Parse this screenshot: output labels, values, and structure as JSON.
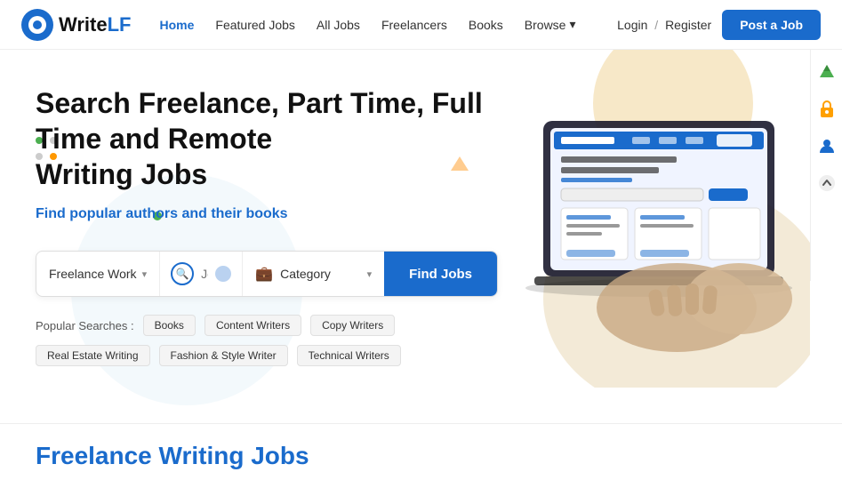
{
  "navbar": {
    "logo_write": "Write",
    "logo_lf": "LF",
    "links": [
      {
        "label": "Home",
        "active": true
      },
      {
        "label": "Featured Jobs",
        "active": false
      },
      {
        "label": "All Jobs",
        "active": false
      },
      {
        "label": "Freelancers",
        "active": false
      },
      {
        "label": "Books",
        "active": false
      },
      {
        "label": "Browse",
        "active": false,
        "has_chevron": true
      }
    ],
    "login": "Login",
    "separator": "/",
    "register": "Register",
    "post_job": "Post a Job"
  },
  "hero": {
    "heading_line1": "Search Freelance, Part Time, Full Time and Remote",
    "heading_line2": "Writing Jobs",
    "subheading": "Find popular authors and their books",
    "search": {
      "type_label": "Freelance Work",
      "placeholder": "Job title, keywords...",
      "category_placeholder": "Category",
      "find_button": "Find Jobs"
    }
  },
  "popular_searches": {
    "label": "Popular Searches :",
    "tags": [
      "Books",
      "Content Writers",
      "Copy Writers",
      "Real Estate Writing",
      "Fashion & Style Writer",
      "Technical Writers"
    ]
  },
  "bottom": {
    "heading": "Freelance Writing Jobs"
  },
  "right_sidebar": {
    "icons": [
      "mountain-icon",
      "lock-icon",
      "person-icon",
      "arrow-up-icon"
    ]
  }
}
